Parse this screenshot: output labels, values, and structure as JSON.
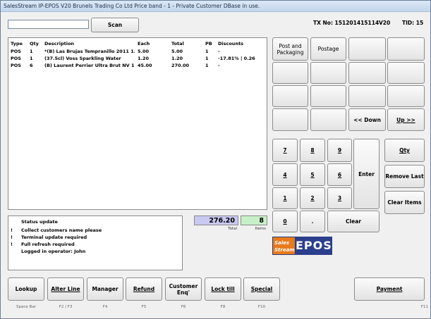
{
  "window": {
    "title": "SalesStream IP-EPOS V20 Brunels Trading Co Ltd Price band - 1 - Private Customer DBase in use."
  },
  "header": {
    "tx_no": "TX No: 151201415114",
    "version": "V20",
    "tid": "TID: 15"
  },
  "search": {
    "value": "",
    "button": "Scan"
  },
  "table": {
    "columns": [
      "Type",
      "Qty",
      "Description",
      "Each",
      "Total",
      "PB",
      "Discounts"
    ],
    "rows": [
      [
        "POS",
        "1",
        "*(B) Las Brujas Tempranillo 2011 1...",
        "5.00",
        "5.00",
        "1",
        "-"
      ],
      [
        "POS",
        "1",
        "(37.5cl) Voss Sparkling Water",
        "1.20",
        "1.20",
        "1",
        "-17.81%  | 0.26"
      ],
      [
        "POS",
        "6",
        "(B) Laurent Perrier Ultra Brut NV 12...",
        "45.00",
        "270.00",
        "1",
        "-"
      ]
    ]
  },
  "quick_keys": {
    "post_packaging": "Post and Packaging",
    "postage": "Postage",
    "down": "<< Down",
    "up": "Up >>"
  },
  "keypad": {
    "k7": "7",
    "k8": "8",
    "k9": "9",
    "k4": "4",
    "k5": "5",
    "k6": "6",
    "k1": "1",
    "k2": "2",
    "k3": "3",
    "k0": "0",
    "dot": ".",
    "enter": "Enter",
    "clear": "Clear"
  },
  "side": {
    "qty": "Qty",
    "remove_last": "Remove Last",
    "clear_items": "Clear Items"
  },
  "status": {
    "title": "Status update",
    "rows": [
      {
        "mark": "!",
        "text": "Collect customers name please"
      },
      {
        "mark": "!",
        "text": "Terminal update required"
      },
      {
        "mark": "!",
        "text": "Full refresh required"
      },
      {
        "mark": "",
        "text": "Logged in operator: John"
      }
    ]
  },
  "totals": {
    "total_value": "276.20",
    "total_label": "Total",
    "items_value": "8",
    "items_label": "Items"
  },
  "logo": {
    "line1": "Sales",
    "line2": "Stream",
    "epos": "EPOS"
  },
  "bottom": {
    "lookup": "Lookup",
    "alter_line": "Alter Line",
    "manager": "Manager",
    "refund": "Refund",
    "customer_enq": "Customer Enq'",
    "lock_till": "Lock till",
    "special": "Special",
    "payment": "Payment"
  },
  "fkeys": {
    "f_lookup": "Space Bar",
    "f_alter": "F2 / F3",
    "f_manager": "F4",
    "f_refund": "F5",
    "f_customer": "F6",
    "f_lock": "F8",
    "f_special": "F10",
    "f_payment": "F11"
  },
  "colors": {
    "total_bg": "#c8c8f0",
    "items_bg": "#c8f0c8",
    "logo_orange": "#e87a1c",
    "logo_blue": "#2c3f8c"
  }
}
